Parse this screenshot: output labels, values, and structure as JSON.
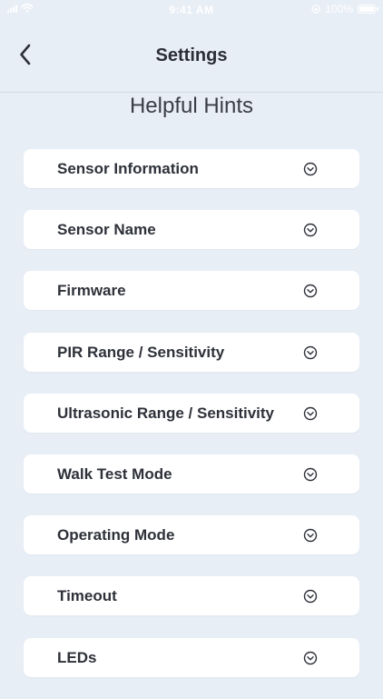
{
  "status_bar": {
    "time": "9:41 AM",
    "battery_percent": "100%"
  },
  "nav": {
    "title": "Settings"
  },
  "section": {
    "heading": "Helpful Hints"
  },
  "hints": [
    {
      "label": "Sensor Information"
    },
    {
      "label": "Sensor Name"
    },
    {
      "label": "Firmware"
    },
    {
      "label": "PIR Range / Sensitivity"
    },
    {
      "label": "Ultrasonic Range / Sensitivity"
    },
    {
      "label": "Walk Test Mode"
    },
    {
      "label": "Operating Mode"
    },
    {
      "label": "Timeout"
    },
    {
      "label": "LEDs"
    }
  ],
  "colors": {
    "background": "#E8EEF6",
    "card": "#FFFFFF",
    "text": "#2E3139",
    "divider": "#D3DAE4"
  },
  "icons": {
    "back": "chevron-left-icon",
    "expand": "chevron-down-circle-icon"
  }
}
